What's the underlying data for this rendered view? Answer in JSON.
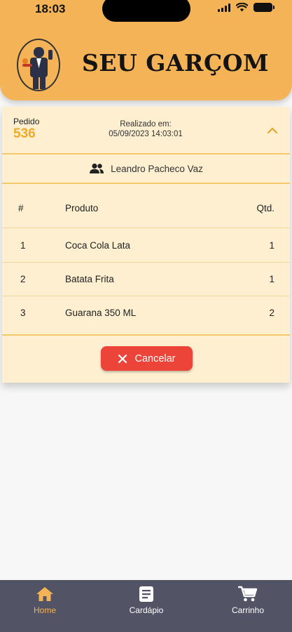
{
  "status_bar": {
    "time": "18:03"
  },
  "header": {
    "brand": "SEU GARÇOM"
  },
  "order": {
    "pedido_label": "Pedido",
    "pedido_number": "536",
    "realizado_label": "Realizado em:",
    "realizado_datetime": "05/09/2023 14:03:01",
    "customer_name": "Leandro Pacheco Vaz",
    "table": {
      "headers": {
        "index": "#",
        "product": "Produto",
        "qty": "Qtd."
      },
      "rows": [
        {
          "index": "1",
          "product": "Coca Cola Lata",
          "qty": "1"
        },
        {
          "index": "2",
          "product": "Batata Frita",
          "qty": "1"
        },
        {
          "index": "3",
          "product": "Guarana 350 ML",
          "qty": "2"
        }
      ]
    },
    "cancel_label": "Cancelar"
  },
  "nav": {
    "items": [
      {
        "label": "Home",
        "icon": "home-icon",
        "active": true
      },
      {
        "label": "Cardápio",
        "icon": "menu-book-icon",
        "active": false
      },
      {
        "label": "Carrinho",
        "icon": "cart-icon",
        "active": false
      }
    ]
  },
  "colors": {
    "accent": "#f4b357",
    "card_bg": "#fdefcf",
    "order_number": "#f0aa2a",
    "cancel": "#ec4438",
    "nav_bg": "#525365"
  }
}
